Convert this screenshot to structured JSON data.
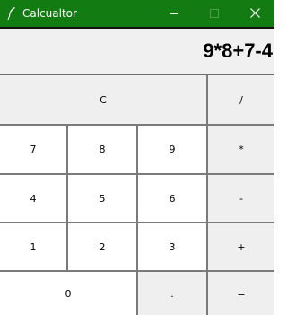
{
  "window": {
    "title": "Calcualtor",
    "app_icon": "feather-icon",
    "title_bar_color": "#127c12",
    "controls": [
      "minimize-icon",
      "maximize-icon",
      "close-icon"
    ]
  },
  "display": {
    "expression": "9*8+7-4"
  },
  "keys": {
    "clear": "C",
    "divide": "/",
    "seven": "7",
    "eight": "8",
    "nine": "9",
    "multiply": "*",
    "four": "4",
    "five": "5",
    "six": "6",
    "subtract": "-",
    "one": "1",
    "two": "2",
    "three": "3",
    "add": "+",
    "zero": "0",
    "decimal": ".",
    "equals": "="
  },
  "colors": {
    "operator_key": "#efefef",
    "number_key": "#ffffff",
    "display_bg": "#f0f0f0"
  }
}
